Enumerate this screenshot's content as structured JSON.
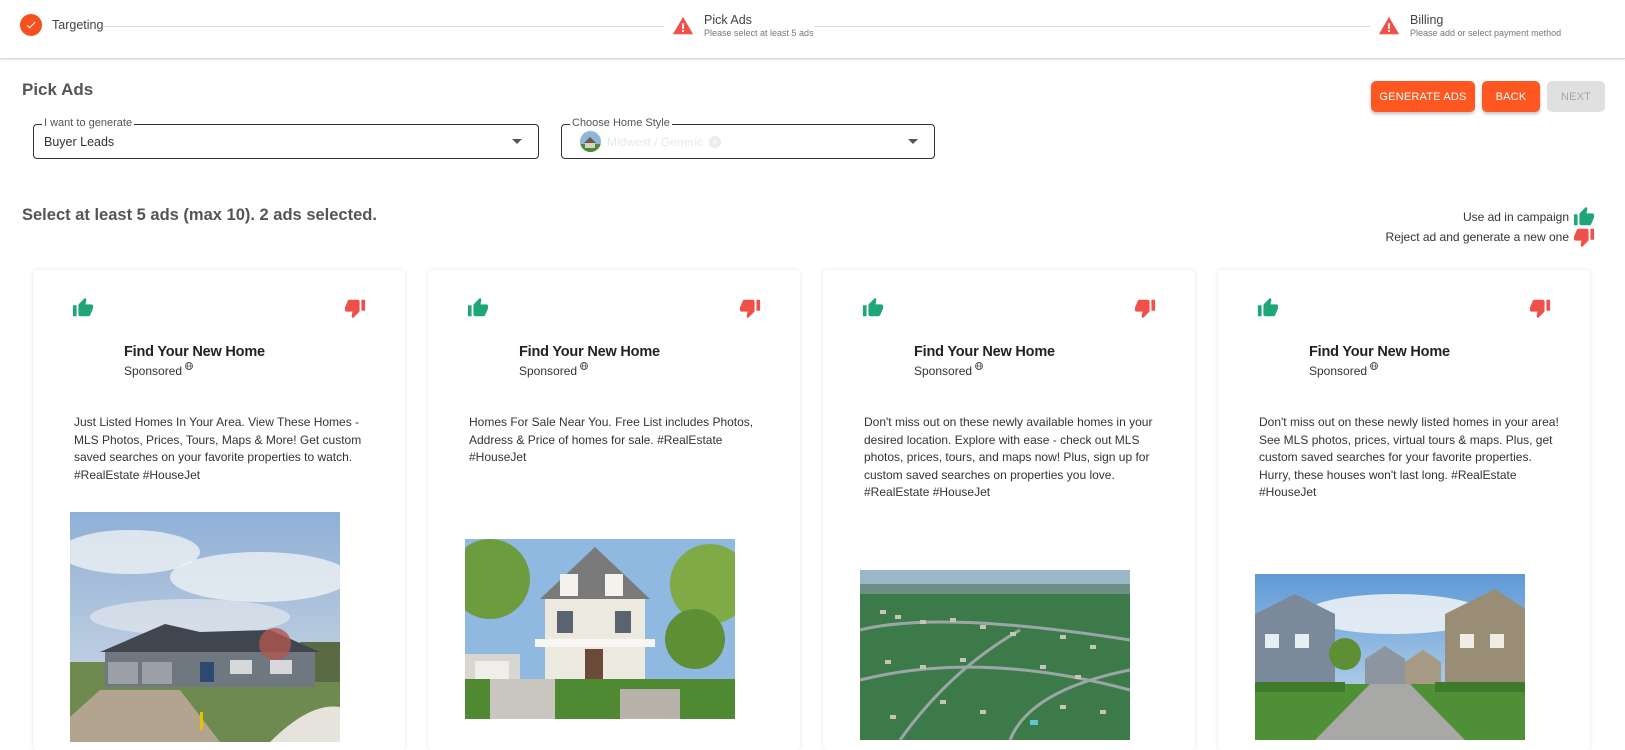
{
  "stepper": {
    "steps": [
      {
        "label": "Targeting",
        "sub": "",
        "status": "complete"
      },
      {
        "label": "Pick Ads",
        "sub": "Please select at least 5 ads",
        "status": "warning"
      },
      {
        "label": "Billing",
        "sub": "Please add or select payment method",
        "status": "warning"
      }
    ]
  },
  "header": {
    "title": "Pick Ads",
    "buttons": {
      "generate": "GENERATE ADS",
      "back": "BACK",
      "next": "NEXT"
    }
  },
  "form": {
    "generate": {
      "label": "I want to generate",
      "value": "Buyer Leads"
    },
    "home_style": {
      "label": "Choose Home Style",
      "value": "Midwest / Generic"
    }
  },
  "selection": {
    "text": "Select at least 5 ads (max 10). 2 ads selected.",
    "use_label": "Use ad in campaign",
    "reject_label": "Reject ad and generate a new one"
  },
  "colors": {
    "accent": "#ff5722",
    "approve": "#1ea67a",
    "reject": "#f0504a"
  },
  "ads": [
    {
      "title": "Find Your New Home",
      "sponsored": "Sponsored",
      "body": "Just Listed Homes In Your Area. View These Homes - MLS Photos, Prices, Tours, Maps & More! Get custom saved searches on your favorite properties to watch. #RealEstate #HouseJet",
      "image": "house-photo-cloudy"
    },
    {
      "title": "Find Your New Home",
      "sponsored": "Sponsored",
      "body": "Homes For Sale Near You. Free List includes Photos, Address & Price of homes for sale. #RealEstate #HouseJet",
      "image": "white-house-photo"
    },
    {
      "title": "Find Your New Home",
      "sponsored": "Sponsored",
      "body": "Don't miss out on these newly available homes in your desired location. Explore with ease - check out MLS photos, prices, tours, and maps now! Plus, sign up for custom saved searches on properties you love. #RealEstate #HouseJet",
      "image": "aerial-neighborhood-photo"
    },
    {
      "title": "Find Your New Home",
      "sponsored": "Sponsored",
      "body": "Don't miss out on these newly listed homes in your area! See MLS photos, prices, virtual tours & maps. Plus, get custom saved searches for your favorite properties. Hurry, these houses won't last long. #RealEstate #HouseJet",
      "image": "suburban-street-photo"
    }
  ]
}
